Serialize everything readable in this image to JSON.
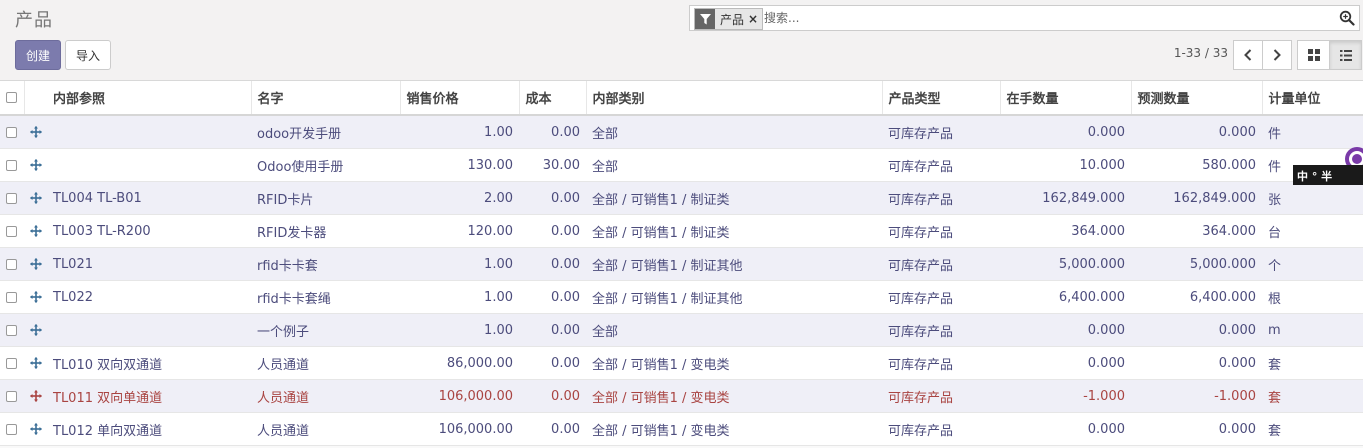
{
  "page": {
    "title": "产品"
  },
  "search": {
    "facet_label": "产品",
    "facet_remove": "×",
    "placeholder": "搜索..."
  },
  "buttons": {
    "create": "创建",
    "import": "导入"
  },
  "pager": {
    "value": "1-33 / 33"
  },
  "columns": [
    "内部参照",
    "名字",
    "销售价格",
    "成本",
    "内部类别",
    "产品类型",
    "在手数量",
    "预测数量",
    "计量单位"
  ],
  "rows": [
    {
      "ref": "",
      "name": "odoo开发手册",
      "price": "1.00",
      "cost": "0.00",
      "category": "全部",
      "type": "可库存产品",
      "onhand": "0.000",
      "forecast": "0.000",
      "uom": "件",
      "danger": false
    },
    {
      "ref": "",
      "name": "Odoo使用手册",
      "price": "130.00",
      "cost": "30.00",
      "category": "全部",
      "type": "可库存产品",
      "onhand": "10.000",
      "forecast": "580.000",
      "uom": "件",
      "danger": false
    },
    {
      "ref": "TL004 TL-B01",
      "name": "RFID卡片",
      "price": "2.00",
      "cost": "0.00",
      "category": "全部 / 可销售1 / 制证类",
      "type": "可库存产品",
      "onhand": "162,849.000",
      "forecast": "162,849.000",
      "uom": "张",
      "danger": false
    },
    {
      "ref": "TL003 TL-R200",
      "name": "RFID发卡器",
      "price": "120.00",
      "cost": "0.00",
      "category": "全部 / 可销售1 / 制证类",
      "type": "可库存产品",
      "onhand": "364.000",
      "forecast": "364.000",
      "uom": "台",
      "danger": false
    },
    {
      "ref": "TL021",
      "name": "rfid卡卡套",
      "price": "1.00",
      "cost": "0.00",
      "category": "全部 / 可销售1 / 制证其他",
      "type": "可库存产品",
      "onhand": "5,000.000",
      "forecast": "5,000.000",
      "uom": "个",
      "danger": false
    },
    {
      "ref": "TL022",
      "name": "rfid卡卡套绳",
      "price": "1.00",
      "cost": "0.00",
      "category": "全部 / 可销售1 / 制证其他",
      "type": "可库存产品",
      "onhand": "6,400.000",
      "forecast": "6,400.000",
      "uom": "根",
      "danger": false
    },
    {
      "ref": "",
      "name": "一个例子",
      "price": "1.00",
      "cost": "0.00",
      "category": "全部",
      "type": "可库存产品",
      "onhand": "0.000",
      "forecast": "0.000",
      "uom": "m",
      "danger": false
    },
    {
      "ref": "TL010 双向双通道",
      "name": "人员通道",
      "price": "86,000.00",
      "cost": "0.00",
      "category": "全部 / 可销售1 / 变电类",
      "type": "可库存产品",
      "onhand": "0.000",
      "forecast": "0.000",
      "uom": "套",
      "danger": false
    },
    {
      "ref": "TL011 双向单通道",
      "name": "人员通道",
      "price": "106,000.00",
      "cost": "0.00",
      "category": "全部 / 可销售1 / 变电类",
      "type": "可库存产品",
      "onhand": "-1.000",
      "forecast": "-1.000",
      "uom": "套",
      "danger": true
    },
    {
      "ref": "TL012 单向双通道",
      "name": "人员通道",
      "price": "106,000.00",
      "cost": "0.00",
      "category": "全部 / 可销售1 / 变电类",
      "type": "可库存产品",
      "onhand": "0.000",
      "forecast": "0.000",
      "uom": "套",
      "danger": false
    }
  ],
  "badge_text": "中 ° 半 ",
  "colors": {
    "primary": "#7c7bad",
    "row_text": "#4c4c7c",
    "danger": "#a94442",
    "odd_row": "#efeff7"
  }
}
